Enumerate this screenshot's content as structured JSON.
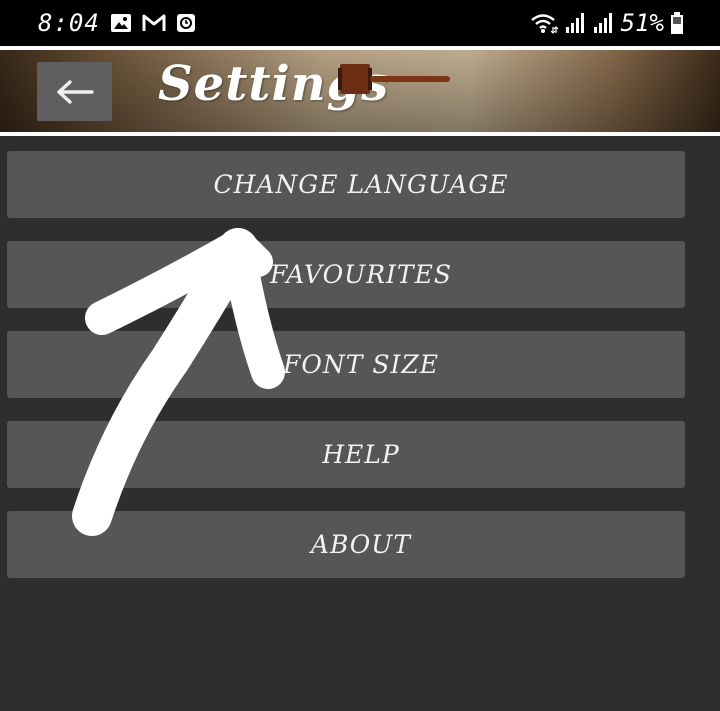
{
  "status_bar": {
    "time": "8:04",
    "battery_percent": "51%",
    "notification_icons": [
      "gallery-icon",
      "gmail-icon",
      "clock-app-icon"
    ],
    "system_icons": [
      "wifi-icon",
      "signal-icon",
      "signal-icon",
      "battery-icon"
    ]
  },
  "header": {
    "title": "Settings",
    "back_icon": "arrow-left-icon",
    "background_image": "gavel-wood-banner"
  },
  "menu": {
    "items": [
      {
        "label": "CHANGE LANGUAGE"
      },
      {
        "label": "FAVOURITES"
      },
      {
        "label": "FONT SIZE"
      },
      {
        "label": "HELP"
      },
      {
        "label": "ABOUT"
      }
    ]
  },
  "annotation": {
    "type": "hand-drawn-arrow",
    "color": "#ffffff",
    "points_to": "CHANGE LANGUAGE"
  },
  "colors": {
    "background": "#2e2e2e",
    "button": "#565656",
    "status_bar": "#000000",
    "text": "#f2f2f2"
  }
}
